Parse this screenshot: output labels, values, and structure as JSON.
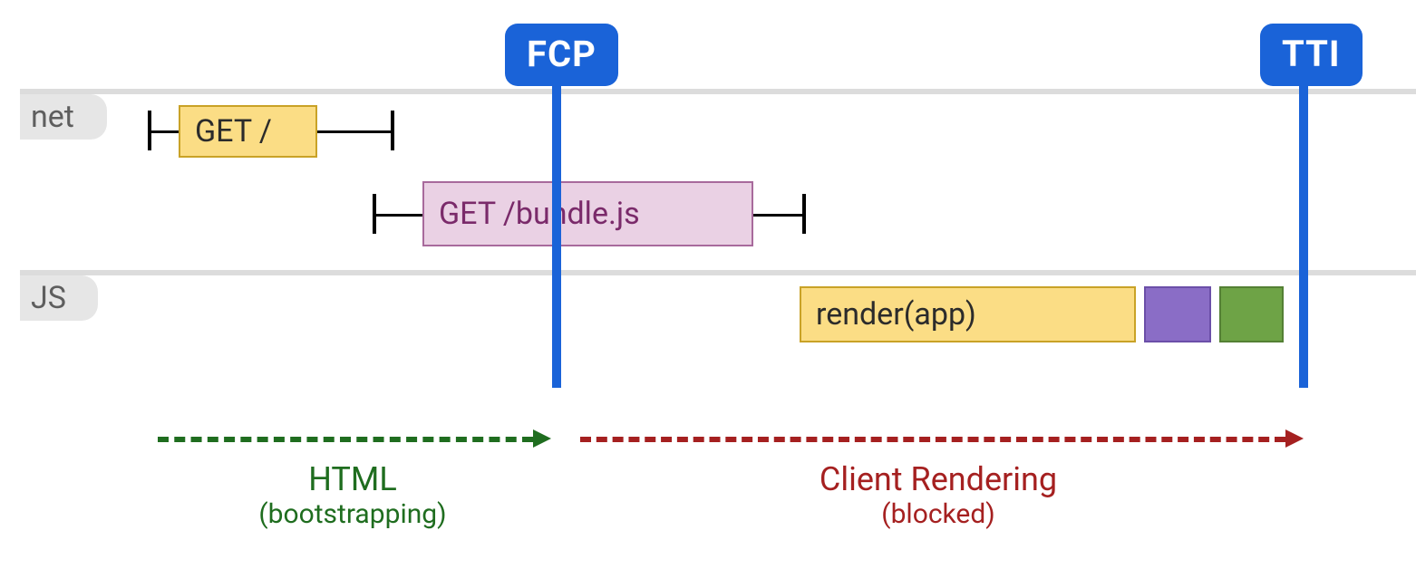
{
  "lanes": {
    "net": "net",
    "js": "JS"
  },
  "markers": {
    "fcp": "FCP",
    "tti": "TTI"
  },
  "blocks": {
    "get_root": "GET /",
    "get_bundle": "GET /bundle.js",
    "render_app": "render(app)"
  },
  "annotations": {
    "html_title": "HTML",
    "html_sub": "(bootstrapping)",
    "client_title": "Client Rendering",
    "client_sub": "(blocked)"
  },
  "chart_data": {
    "type": "timeline",
    "x_range": [
      0,
      1500
    ],
    "markers": [
      {
        "name": "FCP",
        "x": 614
      },
      {
        "name": "TTI",
        "x": 1438
      }
    ],
    "lanes": [
      {
        "name": "net",
        "items": [
          {
            "label": "GET /",
            "color": "#fbdd85",
            "bar": [
              197,
              350
            ],
            "whisker": [
              164,
              434
            ]
          },
          {
            "label": "GET /bundle.js",
            "color": "#ead1e4",
            "bar": [
              466,
              831
            ],
            "whisker": [
              412,
              888
            ]
          }
        ]
      },
      {
        "name": "JS",
        "items": [
          {
            "label": "render(app)",
            "color": "#fbdd85",
            "bar": [
              882,
              1253
            ]
          },
          {
            "label": "",
            "color": "#8a6dc6",
            "bar": [
              1262,
              1336
            ]
          },
          {
            "label": "",
            "color": "#6ea346",
            "bar": [
              1345,
              1416
            ]
          }
        ]
      }
    ],
    "phases": [
      {
        "label": "HTML",
        "sublabel": "(bootstrapping)",
        "color": "#1f6d1f",
        "range": [
          174,
          598
        ]
      },
      {
        "label": "Client Rendering",
        "sublabel": "(blocked)",
        "color": "#a52020",
        "range": [
          640,
          1430
        ]
      }
    ]
  }
}
